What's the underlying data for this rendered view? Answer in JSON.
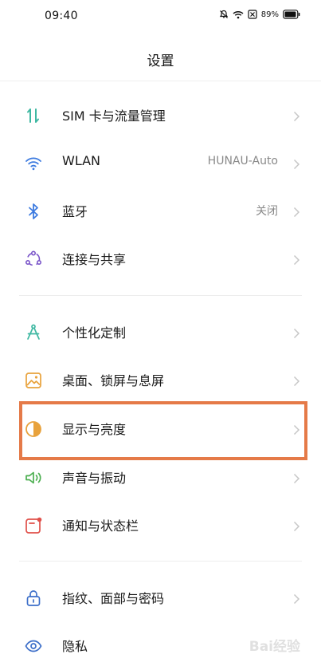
{
  "status": {
    "time": "09:40",
    "battery": "89%",
    "icons": [
      "bell-off-icon",
      "wifi-icon",
      "sim-off-icon",
      "battery-icon"
    ]
  },
  "header": {
    "title": "设置"
  },
  "groups": [
    {
      "items": [
        {
          "label": "SIM 卡与流量管理",
          "value": "",
          "icon": "sim-data-icon"
        },
        {
          "label": "WLAN",
          "value": "HUNAU-Auto",
          "icon": "wifi-icon"
        },
        {
          "label": "蓝牙",
          "value": "关闭",
          "icon": "bluetooth-icon"
        },
        {
          "label": "连接与共享",
          "value": "",
          "icon": "share-icon"
        }
      ]
    },
    {
      "items": [
        {
          "label": "个性化定制",
          "value": "",
          "icon": "compass-icon"
        },
        {
          "label": "桌面、锁屏与息屏",
          "value": "",
          "icon": "wallpaper-icon"
        },
        {
          "label": "显示与亮度",
          "value": "",
          "icon": "brightness-icon"
        },
        {
          "label": "声音与振动",
          "value": "",
          "icon": "speaker-icon"
        },
        {
          "label": "通知与状态栏",
          "value": "",
          "icon": "notification-icon"
        }
      ]
    },
    {
      "items": [
        {
          "label": "指纹、面部与密码",
          "value": "",
          "icon": "lock-icon"
        },
        {
          "label": "隐私",
          "value": "",
          "icon": "privacy-eye-icon"
        }
      ]
    }
  ],
  "highlight_color": "#e57a48",
  "watermark": {
    "text": "Bai经验"
  }
}
